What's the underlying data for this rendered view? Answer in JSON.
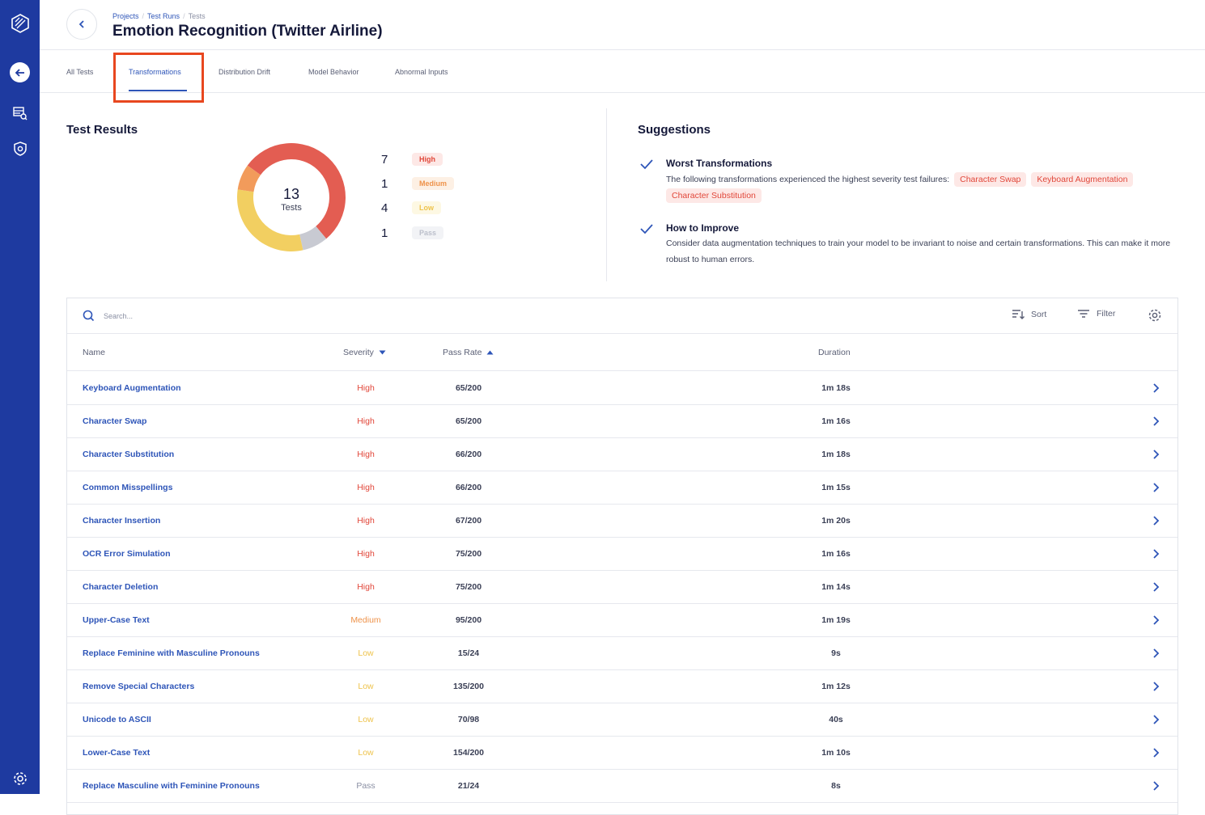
{
  "breadcrumb": {
    "items": [
      "Projects",
      "Test Runs",
      "Tests"
    ]
  },
  "page_title": "Emotion Recognition (Twitter Airline)",
  "tabs": [
    {
      "label": "All Tests",
      "active": false
    },
    {
      "label": "Transformations",
      "active": true
    },
    {
      "label": "Distribution Drift",
      "active": false
    },
    {
      "label": "Model Behavior",
      "active": false
    },
    {
      "label": "Abnormal Inputs",
      "active": false
    }
  ],
  "test_results": {
    "title": "Test Results",
    "total": "13",
    "total_label": "Tests",
    "legend": [
      {
        "count": "7",
        "label": "High",
        "color": "#e35d52"
      },
      {
        "count": "1",
        "label": "Medium",
        "color": "#f29b5b"
      },
      {
        "count": "4",
        "label": "Low",
        "color": "#f2cf61"
      },
      {
        "count": "1",
        "label": "Pass",
        "color": "#c8cad2"
      }
    ]
  },
  "suggestions": {
    "title": "Suggestions",
    "items": [
      {
        "heading": "Worst Transformations",
        "text": "The following transformations experienced the highest severity test failures:",
        "chips": [
          "Character Swap",
          "Keyboard Augmentation",
          "Character Substitution"
        ]
      },
      {
        "heading": "How to Improve",
        "text": "Consider data augmentation techniques to train your model to be invariant to noise and certain transformations. This can make it more robust to human errors."
      }
    ]
  },
  "table": {
    "search_placeholder": "Search...",
    "sort_label": "Sort",
    "filter_label": "Filter",
    "columns": {
      "name": "Name",
      "severity": "Severity",
      "pass_rate": "Pass Rate",
      "duration": "Duration"
    },
    "rows": [
      {
        "name": "Keyboard Augmentation",
        "severity": "High",
        "pass_rate": "65/200",
        "duration": "1m 18s"
      },
      {
        "name": "Character Swap",
        "severity": "High",
        "pass_rate": "65/200",
        "duration": "1m 16s"
      },
      {
        "name": "Character Substitution",
        "severity": "High",
        "pass_rate": "66/200",
        "duration": "1m 18s"
      },
      {
        "name": "Common Misspellings",
        "severity": "High",
        "pass_rate": "66/200",
        "duration": "1m 15s"
      },
      {
        "name": "Character Insertion",
        "severity": "High",
        "pass_rate": "67/200",
        "duration": "1m 20s"
      },
      {
        "name": "OCR Error Simulation",
        "severity": "High",
        "pass_rate": "75/200",
        "duration": "1m 16s"
      },
      {
        "name": "Character Deletion",
        "severity": "High",
        "pass_rate": "75/200",
        "duration": "1m 14s"
      },
      {
        "name": "Upper-Case Text",
        "severity": "Medium",
        "pass_rate": "95/200",
        "duration": "1m 19s"
      },
      {
        "name": "Replace Feminine with Masculine Pronouns",
        "severity": "Low",
        "pass_rate": "15/24",
        "duration": "9s"
      },
      {
        "name": "Remove Special Characters",
        "severity": "Low",
        "pass_rate": "135/200",
        "duration": "1m 12s"
      },
      {
        "name": "Unicode to ASCII",
        "severity": "Low",
        "pass_rate": "70/98",
        "duration": "40s"
      },
      {
        "name": "Lower-Case Text",
        "severity": "Low",
        "pass_rate": "154/200",
        "duration": "1m 10s"
      },
      {
        "name": "Replace Masculine with Feminine Pronouns",
        "severity": "Pass",
        "pass_rate": "21/24",
        "duration": "8s"
      }
    ]
  },
  "icons": {
    "sidebar": [
      "logo-icon",
      "back-arrow-icon",
      "data-search-icon",
      "shield-icon",
      "settings-gear-icon"
    ],
    "accent_color": "#2e55b8",
    "sidebar_color": "#1e3aa0"
  }
}
